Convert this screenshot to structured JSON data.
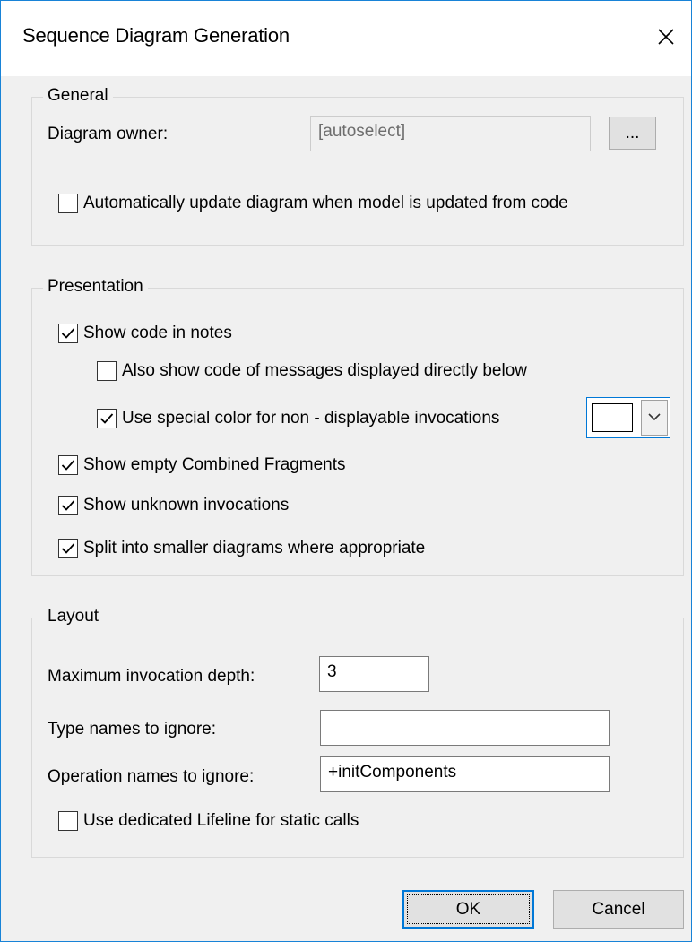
{
  "window": {
    "title": "Sequence Diagram Generation",
    "close_icon": "close-icon"
  },
  "general": {
    "title": "General",
    "diagram_owner_label": "Diagram owner:",
    "diagram_owner_value": "[autoselect]",
    "browse_label": "...",
    "auto_update": {
      "label": "Automatically update diagram when model is updated from code",
      "checked": false
    }
  },
  "presentation": {
    "title": "Presentation",
    "show_code_in_notes": {
      "label": "Show code in notes",
      "checked": true
    },
    "also_show_code": {
      "label": "Also show code of messages displayed directly below",
      "checked": false
    },
    "use_special_color": {
      "label": "Use special color for non - displayable invocations",
      "checked": true
    },
    "special_color": "#ffffff",
    "show_empty_fragments": {
      "label": "Show empty Combined Fragments",
      "checked": true
    },
    "show_unknown_invocations": {
      "label": "Show unknown invocations",
      "checked": true
    },
    "split_diagrams": {
      "label": "Split into smaller diagrams where appropriate",
      "checked": true
    }
  },
  "layout": {
    "title": "Layout",
    "max_depth_label": "Maximum invocation depth:",
    "max_depth_value": "3",
    "type_names_label": "Type names to ignore:",
    "type_names_value": "",
    "operation_names_label": "Operation names to ignore:",
    "operation_names_value": "+initComponents",
    "dedicated_lifeline": {
      "label": "Use dedicated Lifeline for static calls",
      "checked": false
    }
  },
  "buttons": {
    "ok": "OK",
    "cancel": "Cancel"
  },
  "colors": {
    "accent": "#0078d7",
    "window_border": "#1883d7",
    "background": "#f0f0f0"
  }
}
